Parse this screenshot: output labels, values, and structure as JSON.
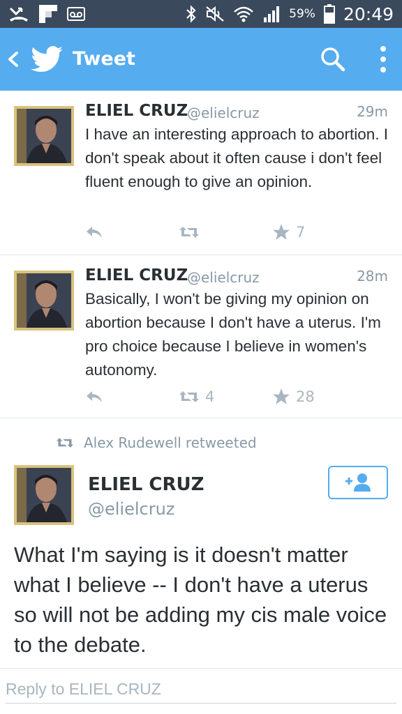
{
  "status_bar": {
    "battery_percent": "59%",
    "time": "20:49",
    "icons": [
      "missed-call-icon",
      "flipboard-icon",
      "voicemail-icon",
      "bluetooth-icon",
      "mute-icon",
      "wifi-icon",
      "signal-icon",
      "battery-icon"
    ]
  },
  "app_bar": {
    "title": "Tweet",
    "icons": [
      "back-icon",
      "twitter-bird-icon",
      "search-icon",
      "more-vertical-icon"
    ],
    "color": "#55acee"
  },
  "tweets": [
    {
      "name": "ELIEL CRUZ",
      "handle": "@elielcruz",
      "time": "29m",
      "text": "I have an interesting approach to abortion. I don't speak about it often cause i don't feel fluent enough to give an opinion.",
      "retweets": "",
      "favorites": "7"
    },
    {
      "name": "ELIEL CRUZ",
      "handle": "@elielcruz",
      "time": "28m",
      "text": "Basically, I won't be giving my opinion on abortion because I don't have a uterus. I'm pro choice because I believe in women's autonomy.",
      "retweets": "4",
      "favorites": "28"
    }
  ],
  "retweet_context": {
    "by": "Alex Rudewell",
    "label": "retweeted"
  },
  "focused_tweet": {
    "name": "ELIEL CRUZ",
    "handle": "@elielcruz",
    "text": "What I'm saying is it doesn't matter what I believe -- I don't have a uterus so will not be adding my cis male voice to the debate."
  },
  "reply": {
    "placeholder": "Reply to ELIEL CRUZ"
  },
  "colors": {
    "accent": "#55acee",
    "status_bar": "#3a4a5c",
    "muted_text": "#8899a6",
    "avatar_frame": "#d8c27e"
  }
}
